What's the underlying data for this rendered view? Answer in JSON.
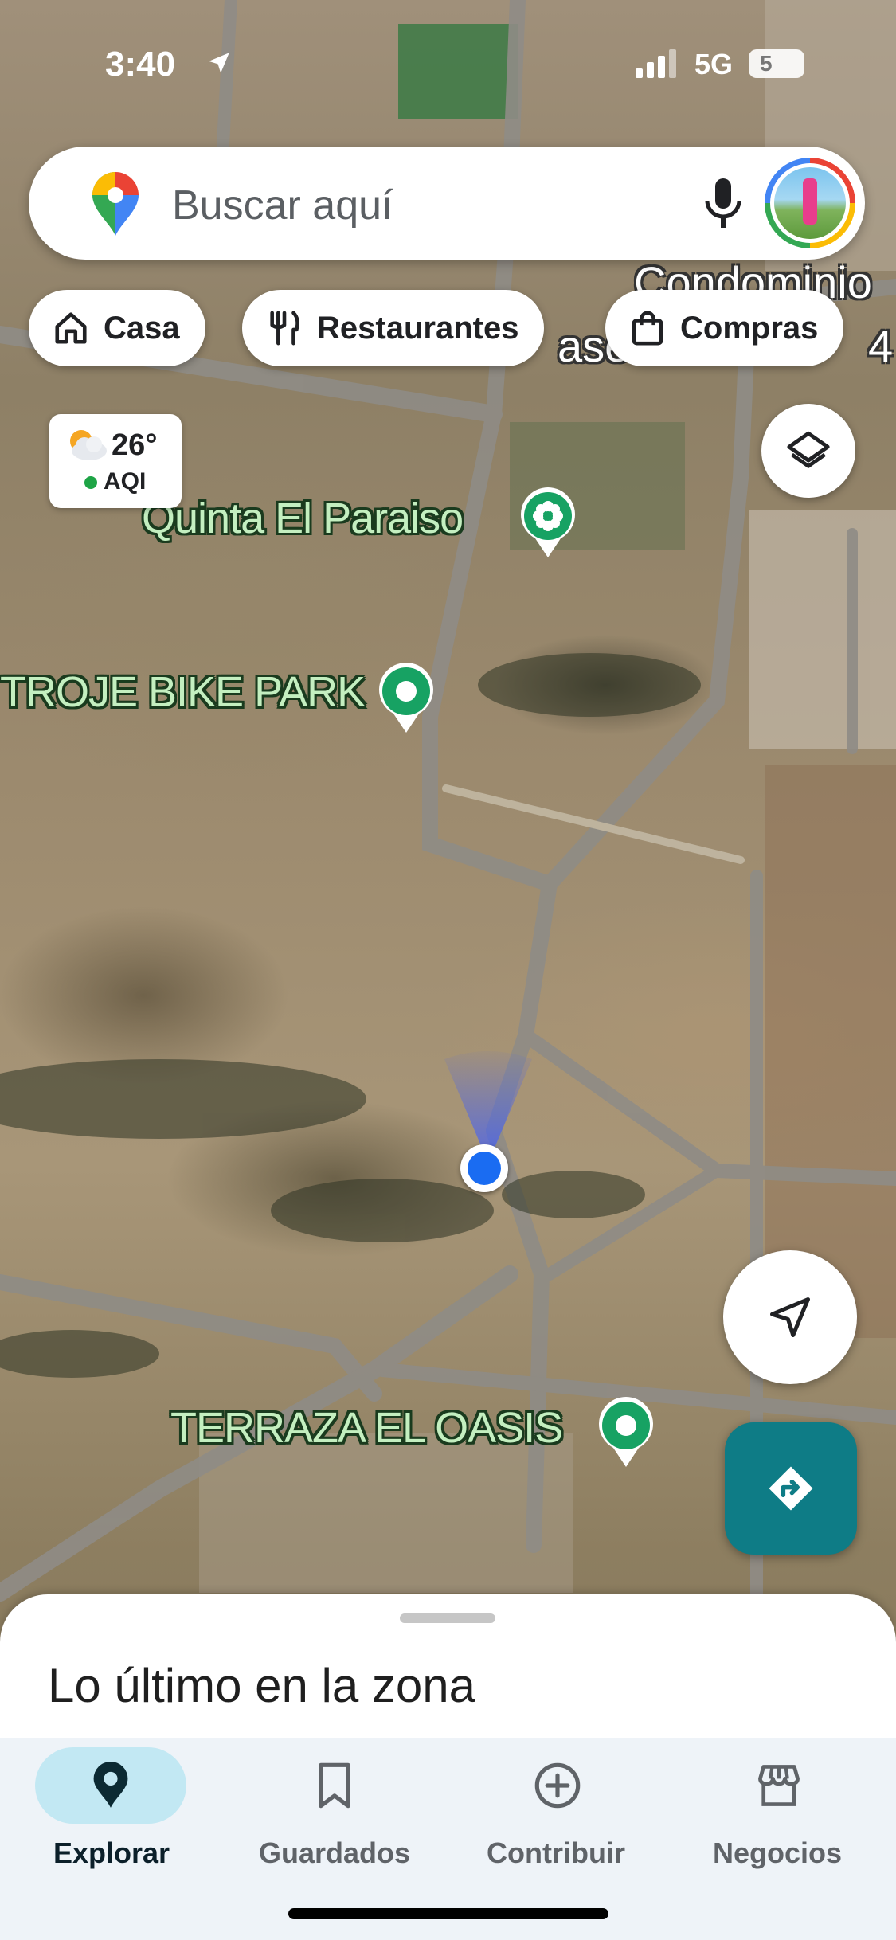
{
  "status_bar": {
    "time": "3:40",
    "network": "5G",
    "battery": "5"
  },
  "search": {
    "placeholder": "Buscar aquí"
  },
  "chips": [
    {
      "label": "Casa",
      "icon": "home-icon"
    },
    {
      "label": "Restaurantes",
      "icon": "fork-knife-icon"
    },
    {
      "label": "Compras",
      "icon": "shopping-bag-icon"
    }
  ],
  "weather": {
    "temp": "26°",
    "aqi_label": "AQI",
    "aqi_color": "#1ea446"
  },
  "map": {
    "area_label_line1": "Condominio",
    "area_label_line2": "ase",
    "area_label_line3": "4",
    "places": [
      {
        "name": "Quinta El Paraiso",
        "icon": "flower-pin-icon"
      },
      {
        "name": "TROJE BIKE PARK",
        "icon": "park-pin-icon"
      },
      {
        "name": "TERRAZA EL OASIS",
        "icon": "park-pin-icon"
      }
    ]
  },
  "sheet": {
    "title": "Lo último en la zona"
  },
  "nav": {
    "items": [
      {
        "label": "Explorar",
        "icon": "location-pin-icon",
        "active": true
      },
      {
        "label": "Guardados",
        "icon": "bookmark-icon",
        "active": false
      },
      {
        "label": "Contribuir",
        "icon": "add-circle-icon",
        "active": false
      },
      {
        "label": "Negocios",
        "icon": "storefront-icon",
        "active": false
      }
    ]
  },
  "colors": {
    "accent_teal": "#0e7c86",
    "location_blue": "#1a6cf2",
    "active_nav_bg": "#c2e8f3"
  }
}
